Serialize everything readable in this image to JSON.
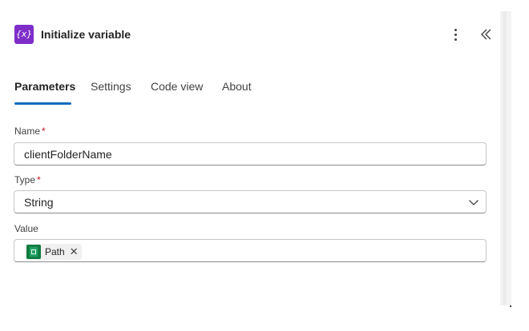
{
  "header": {
    "icon_glyph": "{x}",
    "icon_name": "variable-icon",
    "title": "Initialize variable",
    "accent_color": "#7d2ec9"
  },
  "tabs": [
    {
      "label": "Parameters",
      "active": true
    },
    {
      "label": "Settings",
      "active": false
    },
    {
      "label": "Code view",
      "active": false
    },
    {
      "label": "About",
      "active": false
    }
  ],
  "fields": {
    "name": {
      "label": "Name",
      "required_mark": "*",
      "value": "clientFolderName"
    },
    "type": {
      "label": "Type",
      "required_mark": "*",
      "value": "String"
    },
    "value": {
      "label": "Value",
      "token": {
        "label": "Path",
        "icon": "excel-sheet-icon",
        "remove_glyph": "✕"
      }
    }
  },
  "colors": {
    "tab_underline": "#0f6cbd",
    "required": "#c50f1f",
    "token_icon": "#107c41"
  }
}
